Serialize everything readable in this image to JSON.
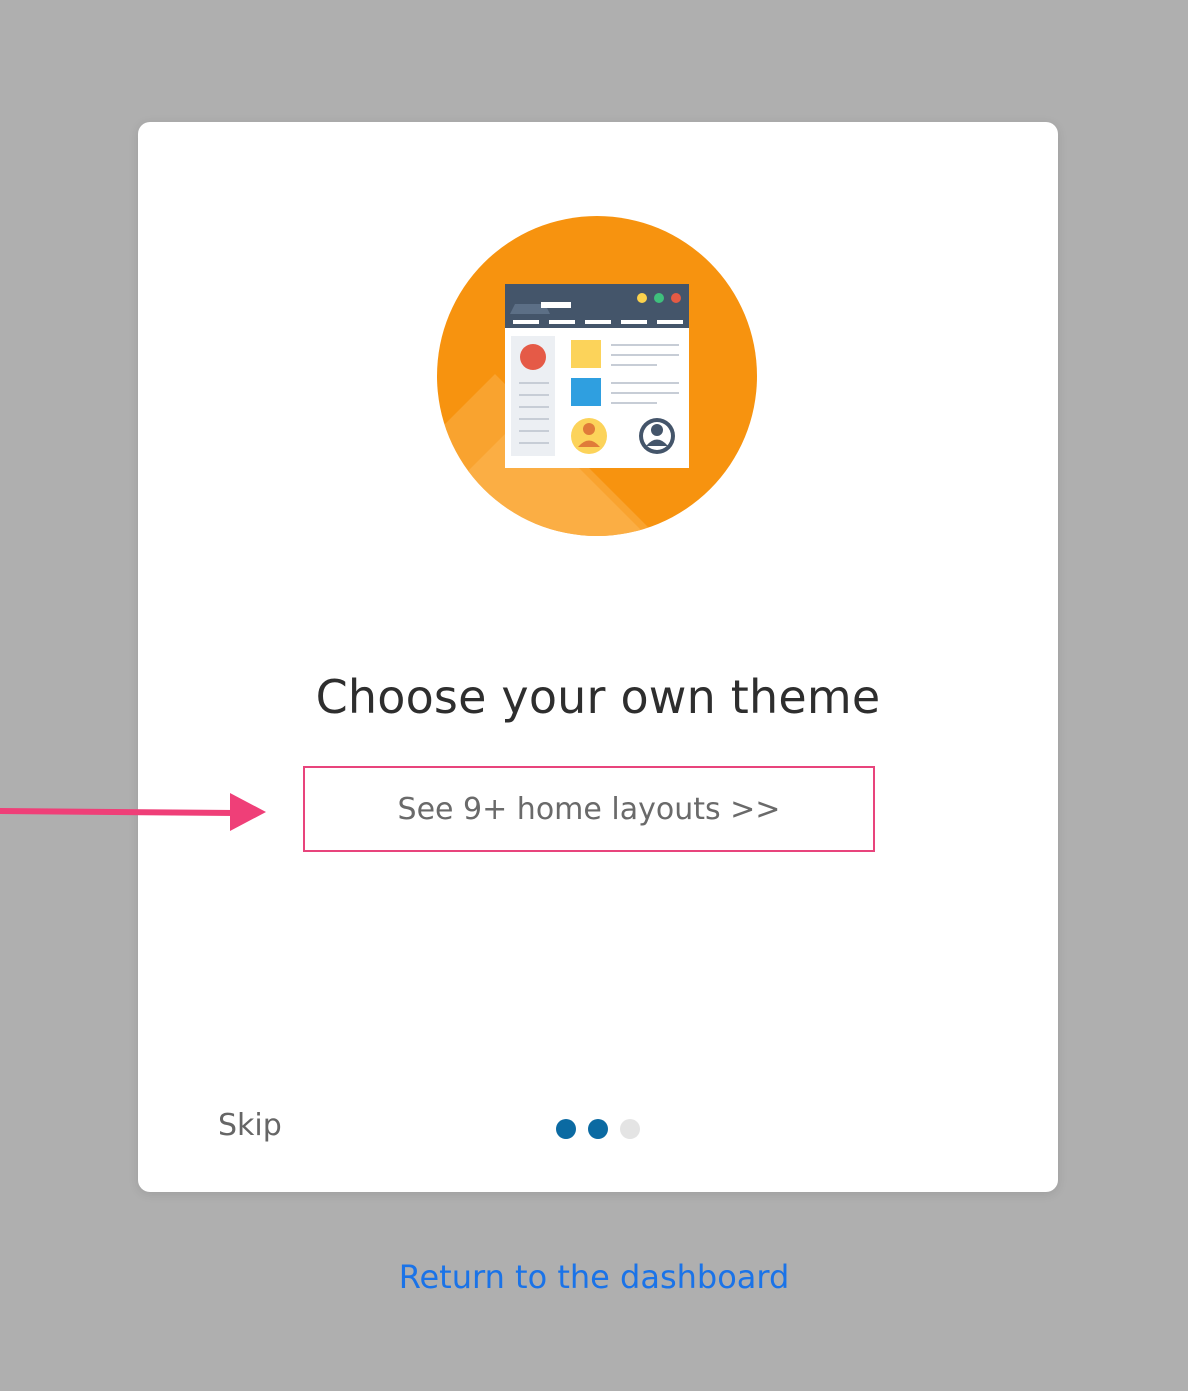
{
  "card": {
    "illustration_icon": "browser-window-icon",
    "title": "Choose your own theme",
    "layouts_button_label": "See 9+ home layouts >>",
    "skip_label": "Skip",
    "pagination": {
      "total": 3,
      "active_color": "#0b6aa2",
      "inactive_color": "#e4e4e4",
      "states": [
        "active",
        "active",
        "inactive"
      ]
    }
  },
  "dashboard_link_label": "Return to the dashboard",
  "colors": {
    "background": "#afafaf",
    "accent_orange": "#f7930f",
    "highlight_border": "#e8447c",
    "link_blue": "#1a73e8"
  }
}
